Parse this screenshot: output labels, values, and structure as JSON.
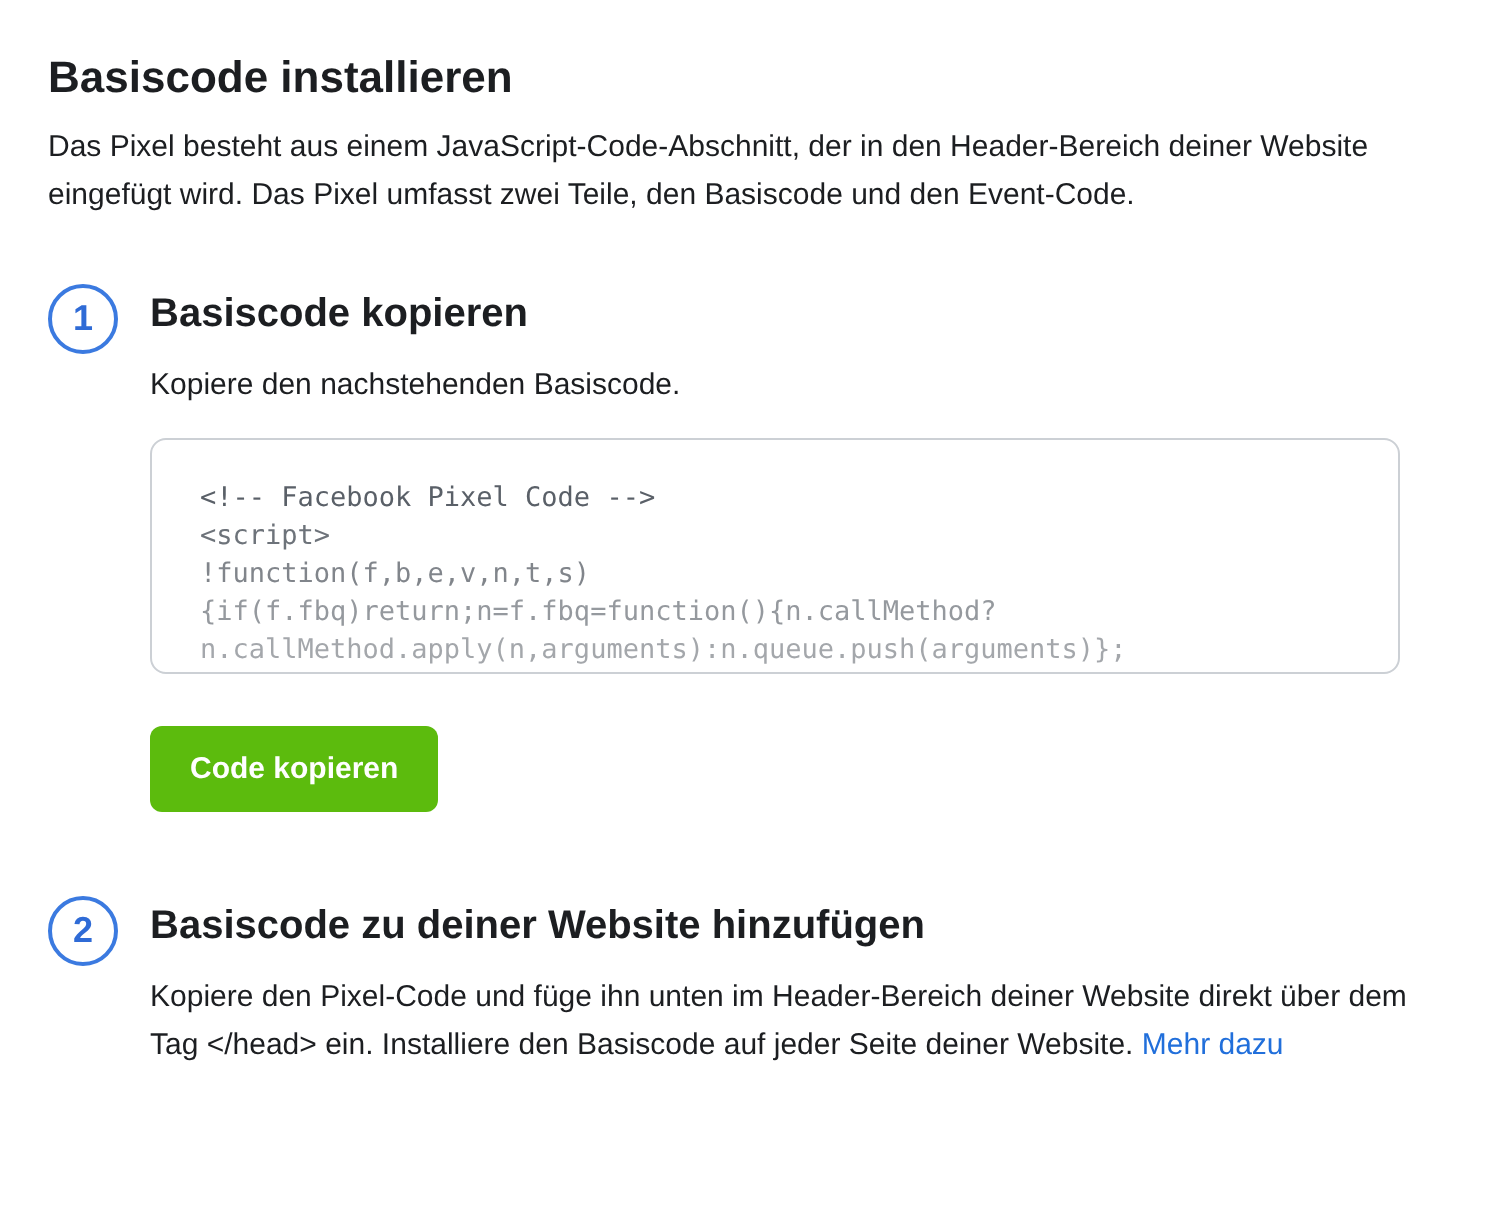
{
  "title": "Basiscode installieren",
  "intro": "Das Pixel besteht aus einem JavaScript-Code-Abschnitt, der in den Header-Bereich deiner Website eingefügt wird. Das Pixel umfasst zwei Teile, den Basiscode und den Event-Code.",
  "steps": [
    {
      "number": "1",
      "title": "Basiscode kopieren",
      "text": "Kopiere den nachstehenden Basiscode.",
      "code_lines": [
        "<!-- Facebook Pixel Code -->",
        "<script>",
        "!function(f,b,e,v,n,t,s)",
        "{if(f.fbq)return;n=f.fbq=function(){n.callMethod?",
        "n.callMethod.apply(n,arguments):n.queue.push(arguments)};"
      ],
      "button": "Code kopieren"
    },
    {
      "number": "2",
      "title": "Basiscode zu deiner Website hinzufügen",
      "text": "Kopiere den Pixel-Code und füge ihn unten im Header-Bereich deiner Website direkt über dem Tag </head> ein. Installiere den Basiscode auf jeder Seite deiner Website.",
      "link": "Mehr dazu"
    }
  ]
}
